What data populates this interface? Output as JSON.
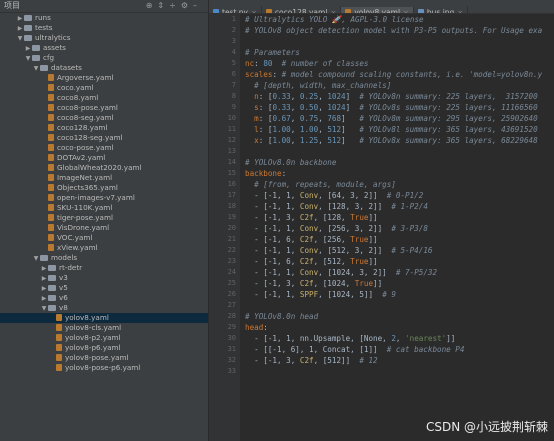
{
  "project_panel": {
    "title": "项目",
    "tool_icons": [
      "target-icon",
      "collapse-icon",
      "expand-icon",
      "settings-icon",
      "minimize-icon"
    ]
  },
  "tree": [
    {
      "indent": 2,
      "type": "folder",
      "open": false,
      "label": "runs"
    },
    {
      "indent": 2,
      "type": "folder",
      "open": false,
      "label": "tests"
    },
    {
      "indent": 2,
      "type": "folder",
      "open": true,
      "label": "ultralytics"
    },
    {
      "indent": 3,
      "type": "folder",
      "open": false,
      "label": "assets"
    },
    {
      "indent": 3,
      "type": "folder",
      "open": true,
      "label": "cfg"
    },
    {
      "indent": 4,
      "type": "folder",
      "open": true,
      "label": "datasets"
    },
    {
      "indent": 5,
      "type": "file",
      "label": "Argoverse.yaml"
    },
    {
      "indent": 5,
      "type": "file",
      "label": "coco.yaml"
    },
    {
      "indent": 5,
      "type": "file",
      "label": "coco8.yaml"
    },
    {
      "indent": 5,
      "type": "file",
      "label": "coco8-pose.yaml"
    },
    {
      "indent": 5,
      "type": "file",
      "label": "coco8-seg.yaml"
    },
    {
      "indent": 5,
      "type": "file",
      "label": "coco128.yaml"
    },
    {
      "indent": 5,
      "type": "file",
      "label": "coco128-seg.yaml"
    },
    {
      "indent": 5,
      "type": "file",
      "label": "coco-pose.yaml"
    },
    {
      "indent": 5,
      "type": "file",
      "label": "DOTAv2.yaml"
    },
    {
      "indent": 5,
      "type": "file",
      "label": "GlobalWheat2020.yaml"
    },
    {
      "indent": 5,
      "type": "file",
      "label": "ImageNet.yaml"
    },
    {
      "indent": 5,
      "type": "file",
      "label": "Objects365.yaml"
    },
    {
      "indent": 5,
      "type": "file",
      "label": "open-images-v7.yaml"
    },
    {
      "indent": 5,
      "type": "file",
      "label": "SKU-110K.yaml"
    },
    {
      "indent": 5,
      "type": "file",
      "label": "tiger-pose.yaml"
    },
    {
      "indent": 5,
      "type": "file",
      "label": "VisDrone.yaml"
    },
    {
      "indent": 5,
      "type": "file",
      "label": "VOC.yaml"
    },
    {
      "indent": 5,
      "type": "file",
      "label": "xView.yaml"
    },
    {
      "indent": 4,
      "type": "folder",
      "open": true,
      "label": "models"
    },
    {
      "indent": 5,
      "type": "folder",
      "open": false,
      "label": "rt-detr"
    },
    {
      "indent": 5,
      "type": "folder",
      "open": false,
      "label": "v3"
    },
    {
      "indent": 5,
      "type": "folder",
      "open": false,
      "label": "v5"
    },
    {
      "indent": 5,
      "type": "folder",
      "open": false,
      "label": "v6"
    },
    {
      "indent": 5,
      "type": "folder",
      "open": true,
      "label": "v8"
    },
    {
      "indent": 6,
      "type": "file",
      "label": "yolov8.yaml",
      "selected": true
    },
    {
      "indent": 6,
      "type": "file",
      "label": "yolov8-cls.yaml"
    },
    {
      "indent": 6,
      "type": "file",
      "label": "yolov8-p2.yaml"
    },
    {
      "indent": 6,
      "type": "file",
      "label": "yolov8-p6.yaml"
    },
    {
      "indent": 6,
      "type": "file",
      "label": "yolov8-pose.yaml"
    },
    {
      "indent": 6,
      "type": "file",
      "label": "yolov8-pose-p6.yaml"
    }
  ],
  "tabs": [
    {
      "label": "test.py",
      "icon_color": "#4a88c7",
      "active": false
    },
    {
      "label": "coco128.yaml",
      "icon_color": "#b9792e",
      "active": false
    },
    {
      "label": "yolov8.yaml",
      "icon_color": "#b9792e",
      "active": true
    },
    {
      "label": "bus.jpg",
      "icon_color": "#6a8fbf",
      "active": false
    }
  ],
  "line_numbers": [
    "1",
    "2",
    "3",
    "4",
    "5",
    "6",
    "7",
    "8",
    "9",
    "10",
    "11",
    "12",
    "13",
    "14",
    "15",
    "16",
    "17",
    "18",
    "19",
    "20",
    "21",
    "22",
    "23",
    "24",
    "25",
    "26",
    "27",
    "28",
    "29",
    "30",
    "31",
    "32",
    "33"
  ],
  "code_lines": [
    [
      [
        "c",
        "# Ultralytics YOLO 🚀, AGPL-3.0 license"
      ]
    ],
    [
      [
        "c",
        "# YOLOv8 object detection model with P3-P5 outputs. For Usage exa"
      ]
    ],
    [
      [
        "t",
        ""
      ]
    ],
    [
      [
        "c",
        "# Parameters"
      ]
    ],
    [
      [
        "k",
        "nc"
      ],
      [
        "t",
        ": "
      ],
      [
        "n",
        "80"
      ],
      [
        "c",
        "  # number of classes"
      ]
    ],
    [
      [
        "k",
        "scales"
      ],
      [
        "t",
        ": "
      ],
      [
        "c",
        "# model compound scaling constants, i.e. 'model=yolov8n.y"
      ]
    ],
    [
      [
        "c",
        "  # [depth, width, max_channels]"
      ]
    ],
    [
      [
        "k",
        "  n"
      ],
      [
        "t",
        ": ["
      ],
      [
        "n",
        "0.33"
      ],
      [
        "t",
        ", "
      ],
      [
        "n",
        "0.25"
      ],
      [
        "t",
        ", "
      ],
      [
        "n",
        "1024"
      ],
      [
        "t",
        "]  "
      ],
      [
        "c",
        "# YOLOv8n summary: 225 layers,  3157200"
      ]
    ],
    [
      [
        "k",
        "  s"
      ],
      [
        "t",
        ": ["
      ],
      [
        "n",
        "0.33"
      ],
      [
        "t",
        ", "
      ],
      [
        "n",
        "0.50"
      ],
      [
        "t",
        ", "
      ],
      [
        "n",
        "1024"
      ],
      [
        "t",
        "]  "
      ],
      [
        "c",
        "# YOLOv8s summary: 225 layers, 11166560"
      ]
    ],
    [
      [
        "k",
        "  m"
      ],
      [
        "t",
        ": ["
      ],
      [
        "n",
        "0.67"
      ],
      [
        "t",
        ", "
      ],
      [
        "n",
        "0.75"
      ],
      [
        "t",
        ", "
      ],
      [
        "n",
        "768"
      ],
      [
        "t",
        "]   "
      ],
      [
        "c",
        "# YOLOv8m summary: 295 layers, 25902640"
      ]
    ],
    [
      [
        "k",
        "  l"
      ],
      [
        "t",
        ": ["
      ],
      [
        "n",
        "1.00"
      ],
      [
        "t",
        ", "
      ],
      [
        "n",
        "1.00"
      ],
      [
        "t",
        ", "
      ],
      [
        "n",
        "512"
      ],
      [
        "t",
        "]   "
      ],
      [
        "c",
        "# YOLOv8l summary: 365 layers, 43691520"
      ]
    ],
    [
      [
        "k",
        "  x"
      ],
      [
        "t",
        ": ["
      ],
      [
        "n",
        "1.00"
      ],
      [
        "t",
        ", "
      ],
      [
        "n",
        "1.25"
      ],
      [
        "t",
        ", "
      ],
      [
        "n",
        "512"
      ],
      [
        "t",
        "]   "
      ],
      [
        "c",
        "# YOLOv8x summary: 365 layers, 68229648"
      ]
    ],
    [
      [
        "t",
        ""
      ]
    ],
    [
      [
        "c",
        "# YOLOv8.0n backbone"
      ]
    ],
    [
      [
        "k",
        "backbone"
      ],
      [
        "t",
        ":"
      ]
    ],
    [
      [
        "c",
        "  # [from, repeats, module, args]"
      ]
    ],
    [
      [
        "t",
        "  - [-1, 1, "
      ],
      [
        "f",
        "Conv"
      ],
      [
        "t",
        ", [64, 3, 2]]  "
      ],
      [
        "c",
        "# 0-P1/2"
      ]
    ],
    [
      [
        "t",
        "  - [-1, 1, "
      ],
      [
        "f",
        "Conv"
      ],
      [
        "t",
        ", [128, 3, 2]]  "
      ],
      [
        "c",
        "# 1-P2/4"
      ]
    ],
    [
      [
        "t",
        "  - [-1, 3, "
      ],
      [
        "f",
        "C2f"
      ],
      [
        "t",
        ", [128, "
      ],
      [
        "k",
        "True"
      ],
      [
        "t",
        "]]"
      ]
    ],
    [
      [
        "t",
        "  - [-1, 1, "
      ],
      [
        "f",
        "Conv"
      ],
      [
        "t",
        ", [256, 3, 2]]  "
      ],
      [
        "c",
        "# 3-P3/8"
      ]
    ],
    [
      [
        "t",
        "  - [-1, 6, "
      ],
      [
        "f",
        "C2f"
      ],
      [
        "t",
        ", [256, "
      ],
      [
        "k",
        "True"
      ],
      [
        "t",
        "]]"
      ]
    ],
    [
      [
        "t",
        "  - [-1, 1, "
      ],
      [
        "f",
        "Conv"
      ],
      [
        "t",
        ", [512, 3, 2]]  "
      ],
      [
        "c",
        "# 5-P4/16"
      ]
    ],
    [
      [
        "t",
        "  - [-1, 6, "
      ],
      [
        "f",
        "C2f"
      ],
      [
        "t",
        ", [512, "
      ],
      [
        "k",
        "True"
      ],
      [
        "t",
        "]]"
      ]
    ],
    [
      [
        "t",
        "  - [-1, 1, "
      ],
      [
        "f",
        "Conv"
      ],
      [
        "t",
        ", [1024, 3, 2]]  "
      ],
      [
        "c",
        "# 7-P5/32"
      ]
    ],
    [
      [
        "t",
        "  - [-1, 3, "
      ],
      [
        "f",
        "C2f"
      ],
      [
        "t",
        ", [1024, "
      ],
      [
        "k",
        "True"
      ],
      [
        "t",
        "]]"
      ]
    ],
    [
      [
        "t",
        "  - [-1, 1, "
      ],
      [
        "f",
        "SPPF"
      ],
      [
        "t",
        ", [1024, 5]]  "
      ],
      [
        "c",
        "# 9"
      ]
    ],
    [
      [
        "t",
        ""
      ]
    ],
    [
      [
        "c",
        "# YOLOv8.0n head"
      ]
    ],
    [
      [
        "k",
        "head"
      ],
      [
        "t",
        ":"
      ]
    ],
    [
      [
        "t",
        "  - [-1, 1, nn.Upsample, [None, "
      ],
      [
        "n",
        "2"
      ],
      [
        "t",
        ", "
      ],
      [
        "s",
        "'nearest'"
      ],
      [
        "t",
        "]]"
      ]
    ],
    [
      [
        "t",
        "  - [[-1, 6], 1, Concat, [1]]  "
      ],
      [
        "c",
        "# cat backbone P4"
      ]
    ],
    [
      [
        "t",
        "  - [-1, 3, "
      ],
      [
        "f",
        "C2f"
      ],
      [
        "t",
        ", [512]]  "
      ],
      [
        "c",
        "# 12"
      ]
    ],
    [
      [
        "t",
        ""
      ]
    ]
  ],
  "watermark": "CSDN @小远披荆斩棘"
}
